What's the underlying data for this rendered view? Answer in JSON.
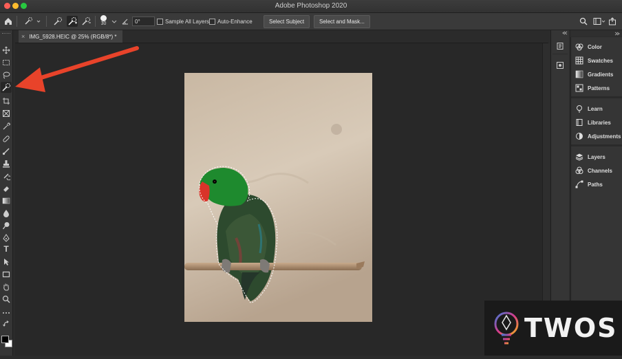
{
  "window": {
    "title": "Adobe Photoshop 2020"
  },
  "options_bar": {
    "brush_size": "30",
    "angle": "0°",
    "sample_all_layers": "Sample All Layers",
    "auto_enhance": "Auto-Enhance",
    "select_subject": "Select Subject",
    "select_and_mask": "Select and Mask..."
  },
  "document": {
    "tab_title": "IMG_5928.HEIC @ 25% (RGB/8*) *",
    "close_glyph": "×"
  },
  "toolbar": {
    "text_tool_glyph": "T"
  },
  "panels": {
    "items": [
      {
        "label": "Color",
        "icon": "color-icon"
      },
      {
        "label": "Swatches",
        "icon": "swatches-icon"
      },
      {
        "label": "Gradients",
        "icon": "gradients-icon"
      },
      {
        "label": "Patterns",
        "icon": "patterns-icon"
      },
      {
        "label": "Learn",
        "icon": "learn-icon"
      },
      {
        "label": "Libraries",
        "icon": "libraries-icon"
      },
      {
        "label": "Adjustments",
        "icon": "adjustments-icon"
      },
      {
        "label": "Layers",
        "icon": "layers-icon"
      },
      {
        "label": "Channels",
        "icon": "channels-icon"
      },
      {
        "label": "Paths",
        "icon": "paths-icon"
      }
    ]
  },
  "watermark": {
    "text": "TWOS"
  },
  "colors": {
    "accent_arrow": "#e8432a",
    "parrot_green": "#1e8a2e",
    "parrot_red": "#d8342a"
  }
}
